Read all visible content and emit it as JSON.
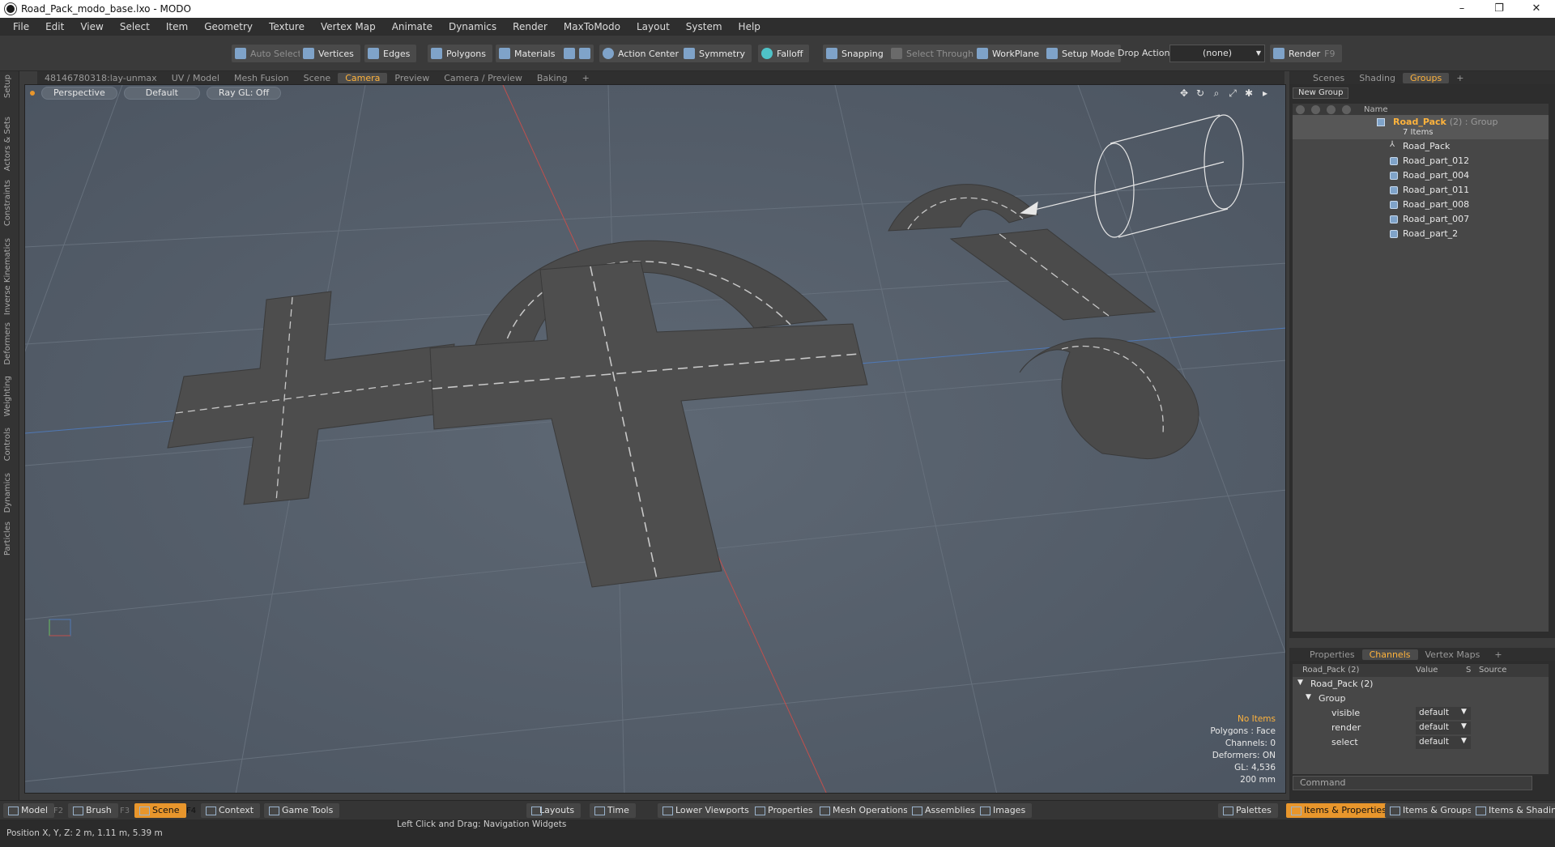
{
  "window": {
    "title": "Road_Pack_modo_base.lxo - MODO",
    "minimize": "–",
    "maximize": "❐",
    "close": "✕"
  },
  "menu": [
    "File",
    "Edit",
    "View",
    "Select",
    "Item",
    "Geometry",
    "Texture",
    "Vertex Map",
    "Animate",
    "Dynamics",
    "Render",
    "MaxToModo",
    "Layout",
    "System",
    "Help"
  ],
  "toolbar": {
    "auto_select": "Auto Select",
    "vertices": "Vertices",
    "edges": "Edges",
    "polygons": "Polygons",
    "materials": "Materials",
    "action_center": "Action Center",
    "symmetry": "Symmetry",
    "falloff": "Falloff",
    "snapping": "Snapping",
    "select_through": "Select Through",
    "workplane": "WorkPlane",
    "setup_mode": "Setup Mode",
    "drop_action": "Drop Action",
    "drop_value": "(none)",
    "render": "Render",
    "render_key": "F9"
  },
  "left_tabs": [
    "Setup",
    "Actors & Sets",
    "Constraints",
    "Inverse Kinematics",
    "Deformers",
    "Weighting",
    "Controls",
    "Dynamics",
    "Particles"
  ],
  "viewport_tabs": [
    "48146780318:lay-unmax",
    "UV / Model",
    "Mesh Fusion",
    "Scene",
    "Camera",
    "Preview",
    "Camera / Preview",
    "Baking",
    "+"
  ],
  "viewport": {
    "view": "Perspective",
    "shading": "Default",
    "raygl": "Ray GL: Off",
    "stats": {
      "items": "No Items",
      "polygons": "Polygons : Face",
      "channels": "Channels: 0",
      "deformers": "Deformers: ON",
      "gl": "GL: 4,536",
      "scale": "200 mm"
    }
  },
  "scene_tabs": [
    "Scenes",
    "Shading",
    "Groups",
    "+"
  ],
  "groups": {
    "new_group": "New Group",
    "column_name": "Name",
    "group_name": "Road_Pack",
    "group_tag": "(2) : Group",
    "group_count": "7 Items",
    "items": [
      "Road_Pack",
      "Road_part_012",
      "Road_part_004",
      "Road_part_011",
      "Road_part_008",
      "Road_part_007",
      "Road_part_2"
    ]
  },
  "props_tabs": [
    "Properties",
    "Channels",
    "Vertex Maps",
    "+"
  ],
  "channels": {
    "header": {
      "name": "Road_Pack (2)",
      "value": "Value",
      "s": "S",
      "source": "Source"
    },
    "root": "Road_Pack (2)",
    "group": "Group",
    "rows": [
      {
        "name": "visible",
        "value": "default"
      },
      {
        "name": "render",
        "value": "default"
      },
      {
        "name": "select",
        "value": "default"
      }
    ]
  },
  "command_placeholder": "Command",
  "bottom": {
    "model": "Model",
    "model_key": "F2",
    "brush": "Brush",
    "brush_key": "F3",
    "scene": "Scene",
    "scene_key": "F4",
    "context": "Context",
    "game_tools": "Game Tools",
    "layouts": "Layouts",
    "time": "Time",
    "lower_viewports": "Lower Viewports",
    "properties": "Properties",
    "mesh_operations": "Mesh Operations",
    "assemblies": "Assemblies",
    "images": "Images",
    "palettes": "Palettes",
    "items_properties": "Items & Properties",
    "items_groups": "Items & Groups",
    "items_shading": "Items & Shading"
  },
  "status": {
    "position": "Position X, Y, Z:   2 m, 1.11 m, 5.39 m",
    "hint": "Left Click and Drag:   Navigation Widgets"
  },
  "colors": {
    "accent": "#ffb33c",
    "viewport_bg": "#56606d",
    "road": "#4d4d4d",
    "stripe": "#c8c8c8"
  }
}
